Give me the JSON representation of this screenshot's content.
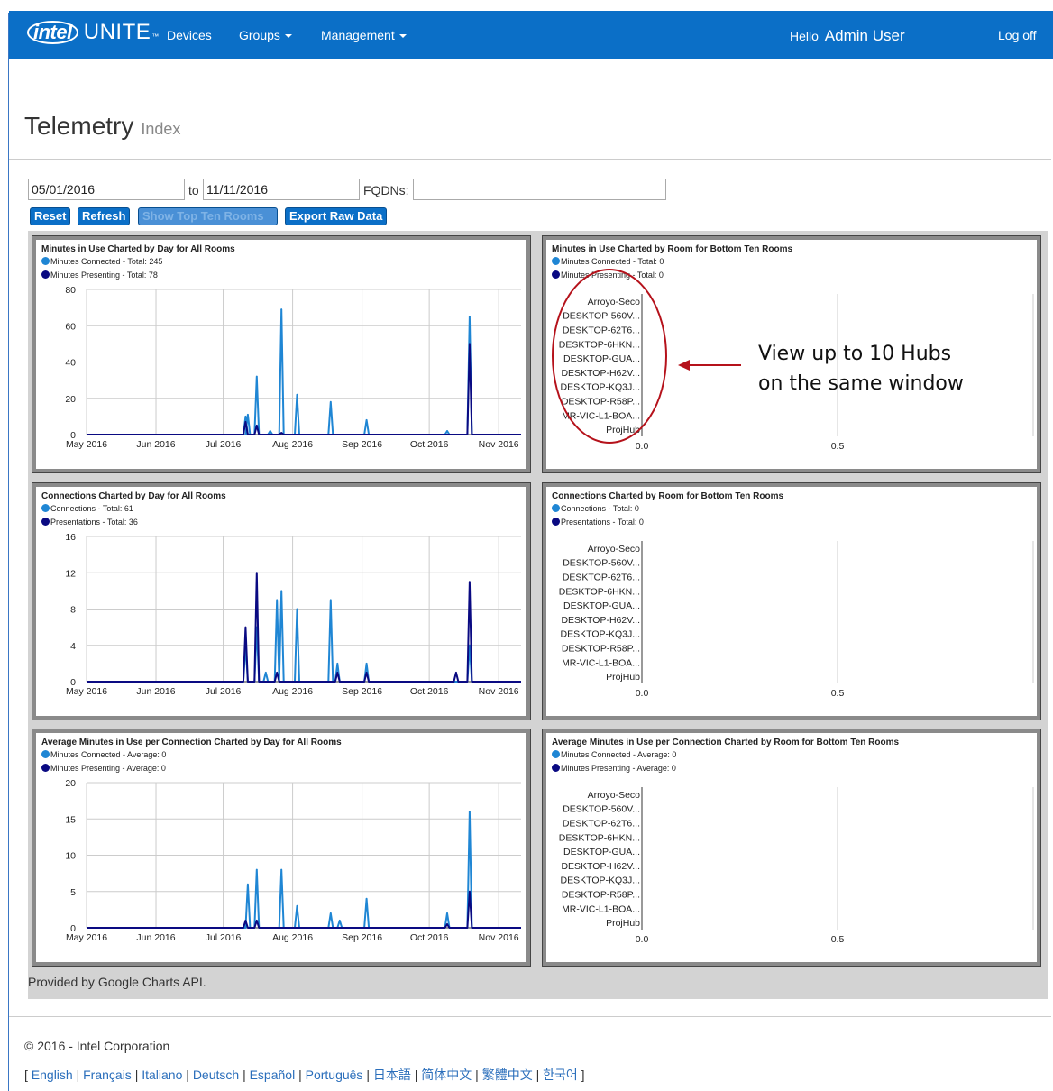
{
  "navbar": {
    "brand_intel": "intel",
    "brand_unite": "UNITE",
    "brand_tm": "™",
    "items": [
      {
        "label": "Devices",
        "dropdown": false
      },
      {
        "label": "Groups",
        "dropdown": true
      },
      {
        "label": "Management",
        "dropdown": true
      }
    ],
    "hello_label": "Hello",
    "user_name": "Admin User",
    "logoff_label": "Log off"
  },
  "page": {
    "title": "Telemetry",
    "subtitle": "Index"
  },
  "filters": {
    "date_from": "05/01/2016",
    "to_label": "to",
    "date_to": "11/11/2016",
    "fqdns_label": "FQDNs:",
    "fqdns_value": ""
  },
  "buttons": {
    "reset": "Reset",
    "refresh": "Refresh",
    "show_top_ten": "Show Top Ten Rooms",
    "export": "Export Raw Data"
  },
  "colors": {
    "series1": "#1f86d4",
    "series2": "#0a0a82",
    "brand": "#0b6fc7",
    "callout": "#b5121b"
  },
  "chart_data": [
    {
      "type": "line",
      "title": "Minutes in Use Charted by Day for All Rooms",
      "x_labels": [
        "May 2016",
        "Jun 2016",
        "Jul 2016",
        "Aug 2016",
        "Sep 2016",
        "Oct 2016",
        "Nov 2016"
      ],
      "ylim": [
        0,
        80
      ],
      "y_ticks": [
        0,
        20,
        40,
        60,
        80
      ],
      "series": [
        {
          "name": "Minutes Connected - Total: 245",
          "color": "#1f86d4",
          "spikes": [
            [
              "2016-07-11",
              10
            ],
            [
              "2016-07-12",
              11
            ],
            [
              "2016-07-16",
              32
            ],
            [
              "2016-07-22",
              2
            ],
            [
              "2016-07-27",
              69
            ],
            [
              "2016-08-03",
              22
            ],
            [
              "2016-08-18",
              18
            ],
            [
              "2016-09-03",
              8
            ],
            [
              "2016-10-09",
              2
            ],
            [
              "2016-10-19",
              65
            ]
          ]
        },
        {
          "name": "Minutes Presenting - Total: 78",
          "color": "#0a0a82",
          "spikes": [
            [
              "2016-07-11",
              7
            ],
            [
              "2016-07-16",
              5
            ],
            [
              "2016-07-27",
              1
            ],
            [
              "2016-10-19",
              50
            ]
          ]
        }
      ]
    },
    {
      "type": "bar",
      "title": "Minutes in Use Charted by Room for Bottom Ten Rooms",
      "categories": [
        "Arroyo-Seco",
        "DESKTOP-560V...",
        "DESKTOP-62T6...",
        "DESKTOP-6HKN...",
        "DESKTOP-GUA...",
        "DESKTOP-H62V...",
        "DESKTOP-KQ3J...",
        "DESKTOP-R58P...",
        "MR-VIC-L1-BOA...",
        "ProjHub"
      ],
      "x_ticks": [
        "0.0",
        "0.5"
      ],
      "series": [
        {
          "name": "Minutes Connected - Total: 0",
          "color": "#1f86d4"
        },
        {
          "name": "Minutes Presenting - Total: 0",
          "color": "#0a0a82"
        }
      ]
    },
    {
      "type": "line",
      "title": "Connections Charted by Day for All Rooms",
      "x_labels": [
        "May 2016",
        "Jun 2016",
        "Jul 2016",
        "Aug 2016",
        "Sep 2016",
        "Oct 2016",
        "Nov 2016"
      ],
      "ylim": [
        0,
        16
      ],
      "y_ticks": [
        0,
        4,
        8,
        12,
        16
      ],
      "series": [
        {
          "name": "Connections - Total: 61",
          "color": "#1f86d4",
          "spikes": [
            [
              "2016-07-11",
              4
            ],
            [
              "2016-07-16",
              6
            ],
            [
              "2016-07-20",
              1
            ],
            [
              "2016-07-25",
              9
            ],
            [
              "2016-07-27",
              10
            ],
            [
              "2016-08-03",
              8
            ],
            [
              "2016-08-18",
              9
            ],
            [
              "2016-08-21",
              2
            ],
            [
              "2016-09-03",
              2
            ],
            [
              "2016-10-19",
              4
            ]
          ]
        },
        {
          "name": "Presentations - Total: 36",
          "color": "#0a0a82",
          "spikes": [
            [
              "2016-07-11",
              6
            ],
            [
              "2016-07-16",
              12
            ],
            [
              "2016-07-25",
              1
            ],
            [
              "2016-08-21",
              1
            ],
            [
              "2016-09-03",
              1
            ],
            [
              "2016-10-13",
              1
            ],
            [
              "2016-10-19",
              11
            ]
          ]
        }
      ]
    },
    {
      "type": "bar",
      "title": "Connections Charted by Room for Bottom Ten Rooms",
      "categories": [
        "Arroyo-Seco",
        "DESKTOP-560V...",
        "DESKTOP-62T6...",
        "DESKTOP-6HKN...",
        "DESKTOP-GUA...",
        "DESKTOP-H62V...",
        "DESKTOP-KQ3J...",
        "DESKTOP-R58P...",
        "MR-VIC-L1-BOA...",
        "ProjHub"
      ],
      "x_ticks": [
        "0.0",
        "0.5"
      ],
      "series": [
        {
          "name": "Connections - Total: 0",
          "color": "#1f86d4"
        },
        {
          "name": "Presentations - Total: 0",
          "color": "#0a0a82"
        }
      ]
    },
    {
      "type": "line",
      "title": "Average Minutes in Use per Connection Charted by Day for All Rooms",
      "x_labels": [
        "May 2016",
        "Jun 2016",
        "Jul 2016",
        "Aug 2016",
        "Sep 2016",
        "Oct 2016",
        "Nov 2016"
      ],
      "ylim": [
        0,
        20
      ],
      "y_ticks": [
        0,
        5,
        10,
        15,
        20
      ],
      "series": [
        {
          "name": "Minutes Connected - Average: 0",
          "color": "#1f86d4",
          "spikes": [
            [
              "2016-07-12",
              6
            ],
            [
              "2016-07-16",
              8
            ],
            [
              "2016-07-27",
              8
            ],
            [
              "2016-08-03",
              3
            ],
            [
              "2016-08-18",
              2
            ],
            [
              "2016-08-22",
              1
            ],
            [
              "2016-09-03",
              4
            ],
            [
              "2016-10-09",
              2
            ],
            [
              "2016-10-19",
              16
            ]
          ]
        },
        {
          "name": "Minutes Presenting - Average: 0",
          "color": "#0a0a82",
          "spikes": [
            [
              "2016-07-11",
              1
            ],
            [
              "2016-07-16",
              1
            ],
            [
              "2016-10-09",
              0.5
            ],
            [
              "2016-10-19",
              5
            ]
          ]
        }
      ]
    },
    {
      "type": "bar",
      "title": "Average Minutes in Use per Connection Charted by Room for Bottom Ten Rooms",
      "categories": [
        "Arroyo-Seco",
        "DESKTOP-560V...",
        "DESKTOP-62T6...",
        "DESKTOP-6HKN...",
        "DESKTOP-GUA...",
        "DESKTOP-H62V...",
        "DESKTOP-KQ3J...",
        "DESKTOP-R58P...",
        "MR-VIC-L1-BOA...",
        "ProjHub"
      ],
      "x_ticks": [
        "0.0",
        "0.5"
      ],
      "series": [
        {
          "name": "Minutes Connected - Average: 0",
          "color": "#1f86d4"
        },
        {
          "name": "Minutes Presenting - Average: 0",
          "color": "#0a0a82"
        }
      ]
    }
  ],
  "chart_credit": "Provided by Google Charts API.",
  "callout": {
    "line1": "View up to 10 Hubs",
    "line2": "on the same window"
  },
  "footer": {
    "copyright": "© 2016 - Intel Corporation",
    "open_bracket": "[",
    "close_bracket": "]",
    "separator": "|",
    "languages": [
      "English",
      "Français",
      "Italiano",
      "Deutsch",
      "Español",
      "Português",
      "日本語",
      "简体中文",
      "繁體中文",
      "한국어"
    ]
  }
}
